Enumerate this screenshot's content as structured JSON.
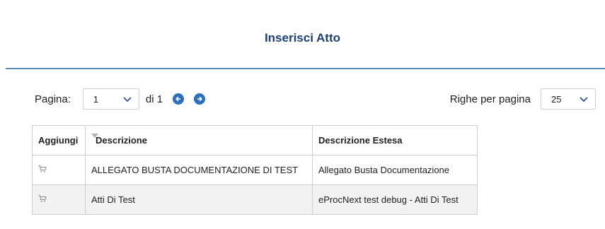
{
  "page": {
    "title": "Inserisci Atto"
  },
  "pager": {
    "label": "Pagina:",
    "current_page": "1",
    "of_label": "di 1",
    "rows_label": "Righe per pagina",
    "rows_value": "25"
  },
  "icons": {
    "prev": "arrow-left-circle-icon",
    "next": "arrow-right-circle-icon",
    "select_chevron": "chevron-down-icon",
    "add": "cart-icon"
  },
  "colors": {
    "title": "#1f3f6e",
    "rule": "#5b89b8",
    "nav_button": "#2d6fbd",
    "alt_row": "#f2f2f2"
  },
  "table": {
    "headers": [
      "Aggiungi",
      "Descrizione",
      "Descrizione Estesa"
    ],
    "rows": [
      {
        "descrizione": "ALLEGATO BUSTA DOCUMENTAZIONE DI TEST",
        "estesa": "Allegato Busta Documentazione"
      },
      {
        "descrizione": "Atti Di Test",
        "estesa": "eProcNext test debug - Atti Di Test"
      }
    ]
  }
}
